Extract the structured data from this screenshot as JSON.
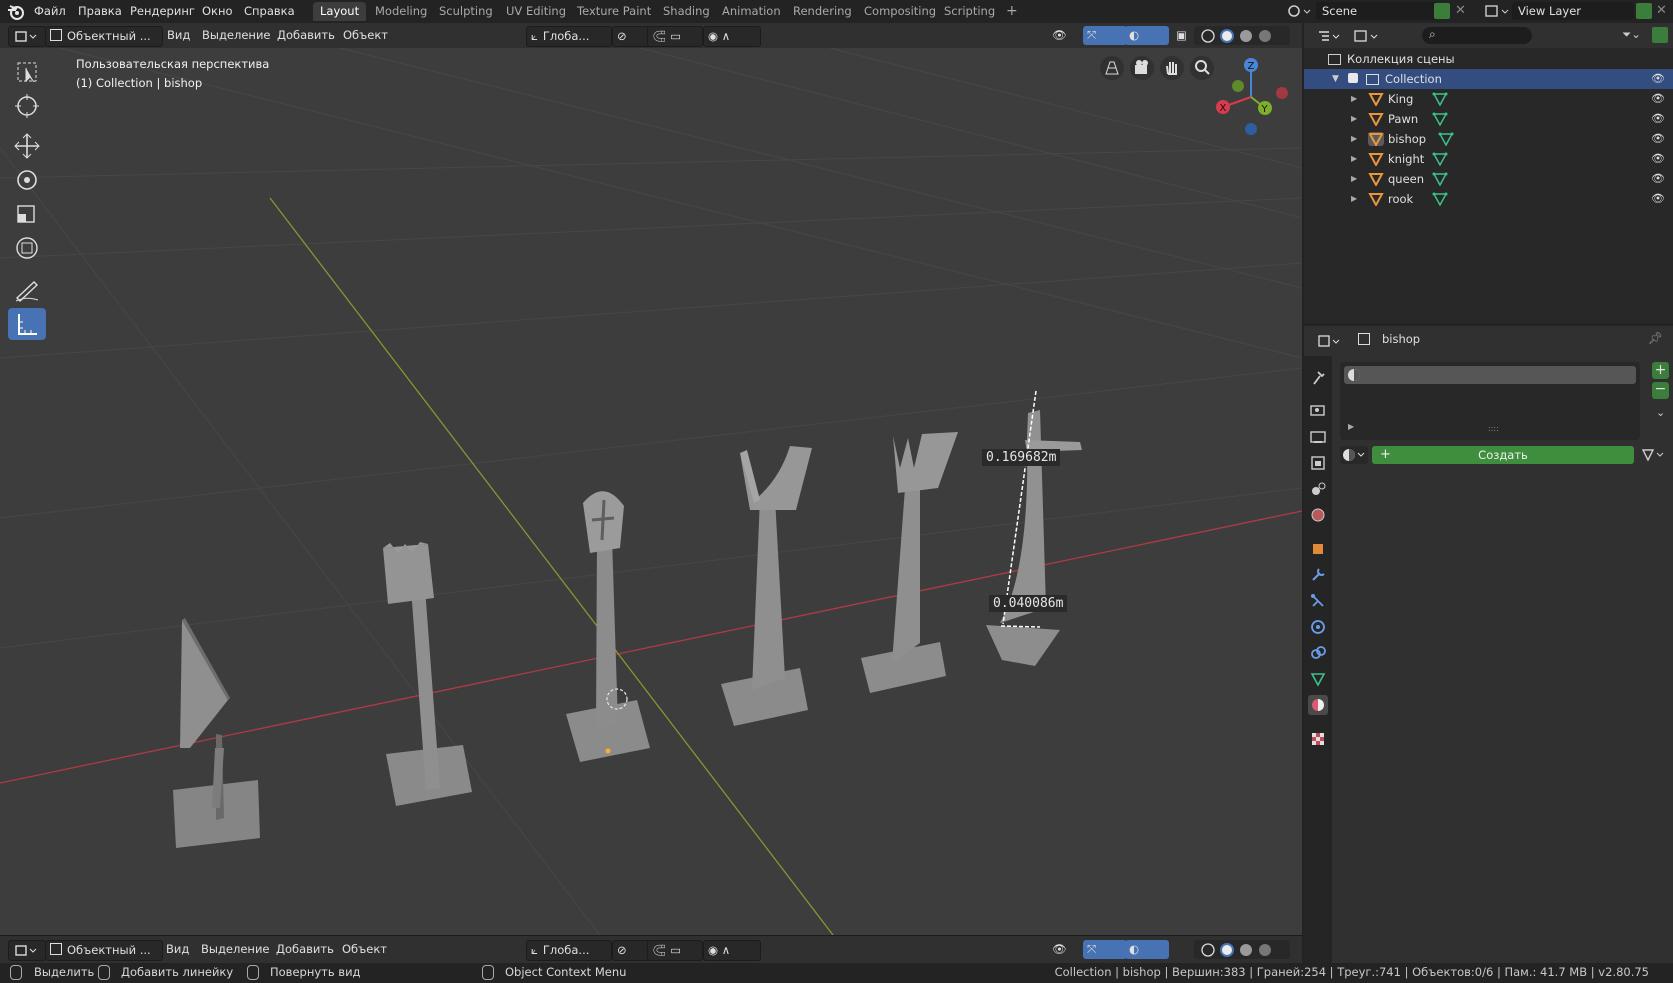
{
  "topbar": {
    "menu": [
      "Файл",
      "Правка",
      "Рендеринг",
      "Окно",
      "Справка"
    ],
    "workspaces": [
      "Layout",
      "Modeling",
      "Sculpting",
      "UV Editing",
      "Texture Paint",
      "Shading",
      "Animation",
      "Rendering",
      "Compositing",
      "Scripting"
    ],
    "active_workspace": "Layout",
    "add_workspace": "+",
    "scene_label": "Scene",
    "view_layer_label": "View Layer"
  },
  "viewport_header": {
    "mode": "Объектный ...",
    "menus": [
      "Вид",
      "Выделение",
      "Добавить",
      "Объект"
    ],
    "orientation": "Глоба..."
  },
  "viewport": {
    "view_name": "Пользовательская перспектива",
    "context": "(1) Collection | bishop",
    "measure_length": "0.169682m",
    "measure_width": "0.040086m",
    "gizmo_axes": [
      "X",
      "Y",
      "Z"
    ],
    "colors": {
      "background": "#3d3d3d",
      "x_axis": "#b03a44",
      "y_axis": "#7f9a31",
      "grid": "#4a4a4a",
      "piece": "#8f8f8f",
      "tool_active": "#4772b3"
    }
  },
  "bottom_header": {
    "mode": "Объектный ...",
    "menus": [
      "Вид",
      "Выделение",
      "Добавить",
      "Объект"
    ],
    "orientation": "Глоба..."
  },
  "outliner": {
    "root": "Коллекция сцены",
    "collection": "Collection",
    "objects": [
      "King",
      "Pawn",
      "bishop",
      "knight",
      "queen",
      "rook"
    ],
    "active_object": "bishop"
  },
  "properties": {
    "object_name": "bishop",
    "new_button": "Создать",
    "list_dots": "::::"
  },
  "status_bar": {
    "hint1": "Выделить",
    "hint2": "Добавить линейку",
    "hint3": "Повернуть вид",
    "context_menu": "Object Context Menu",
    "stats": "Collection | bishop | Вершин:383 | Граней:254 | Треуг.:741 | Объектов:0/6 | Пам.: 41.7 MB | v2.80.75"
  }
}
